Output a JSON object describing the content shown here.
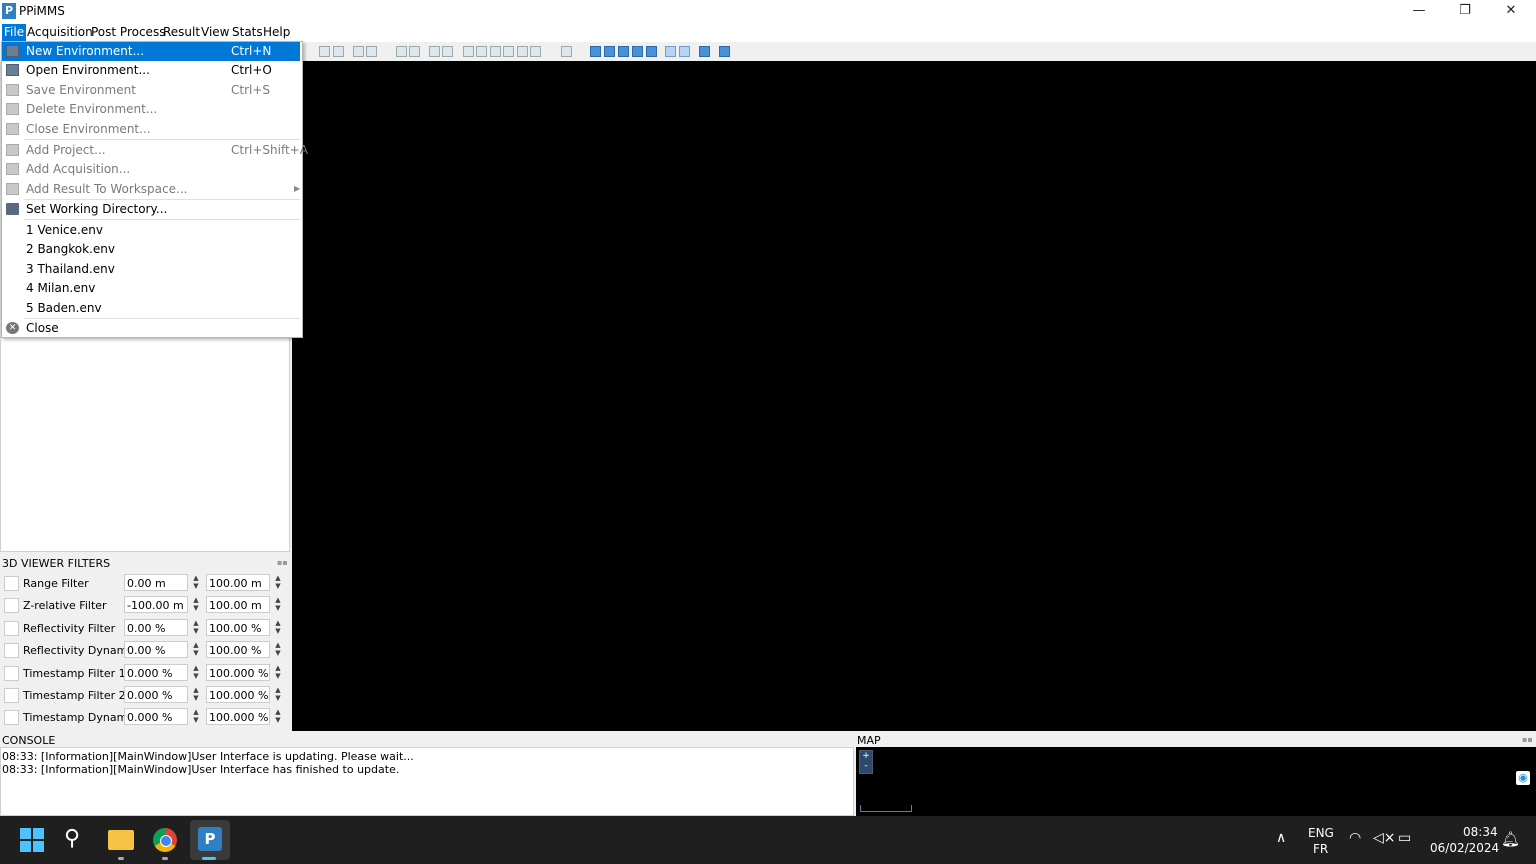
{
  "window": {
    "logo_letter": "P",
    "title": "PPiMMS",
    "controls": {
      "minimize": "—",
      "restore": "❐",
      "close": "✕"
    }
  },
  "menubar": [
    {
      "label": "File"
    },
    {
      "label": "Acquisition"
    },
    {
      "label": "Post Process"
    },
    {
      "label": "Result"
    },
    {
      "label": "View"
    },
    {
      "label": "Stats"
    },
    {
      "label": "Help"
    }
  ],
  "file_menu": {
    "items": [
      {
        "label": "New Environment...",
        "shortcut": "Ctrl+N",
        "enabled": true,
        "highlighted": true
      },
      {
        "label": "Open Environment...",
        "shortcut": "Ctrl+O",
        "enabled": true
      },
      {
        "label": "Save Environment",
        "shortcut": "Ctrl+S",
        "enabled": false
      },
      {
        "label": "Delete Environment...",
        "shortcut": "",
        "enabled": false
      },
      {
        "label": "Close Environment...",
        "shortcut": "",
        "enabled": false
      },
      {
        "label": "Add Project...",
        "shortcut": "Ctrl+Shift+A",
        "enabled": false
      },
      {
        "label": "Add Acquisition...",
        "shortcut": "",
        "enabled": false
      },
      {
        "label": "Add Result To Workspace...",
        "shortcut": "",
        "enabled": false
      },
      {
        "label": "Set Working Directory...",
        "shortcut": "",
        "enabled": true
      }
    ],
    "recent": [
      "1 Venice.env",
      "2 Bangkok.env",
      "3 Thailand.env",
      "4 Milan.env",
      "5 Baden.env"
    ],
    "close_label": "Close"
  },
  "filters": {
    "title": "3D VIEWER FILTERS",
    "rows": [
      {
        "label": "Range Filter",
        "min": "0.00 m",
        "max": "100.00 m"
      },
      {
        "label": "Z-relative Filter",
        "min": "-100.00 m",
        "max": "100.00 m"
      },
      {
        "label": "Reflectivity Filter",
        "min": "0.00 %",
        "max": "100.00 %"
      },
      {
        "label": "Reflectivity Dynamic",
        "min": "0.00 %",
        "max": "100.00 %"
      },
      {
        "label": "Timestamp Filter 1",
        "min": "0.000 %",
        "max": "100.000 %"
      },
      {
        "label": "Timestamp Filter 2",
        "min": "0.000 %",
        "max": "100.000 %"
      },
      {
        "label": "Timestamp Dynamic",
        "min": "0.000 %",
        "max": "100.000 %"
      }
    ]
  },
  "console": {
    "title": "CONSOLE",
    "lines": [
      "08:33: [Information][MainWindow]User Interface is updating. Please wait...",
      "08:33: [Information][MainWindow]User Interface has finished to update."
    ]
  },
  "map": {
    "title": "MAP",
    "zoom_in": "+",
    "zoom_out": "-"
  },
  "taskbar": {
    "language_primary": "ENG",
    "language_secondary": "FR",
    "time": "08:34",
    "date": "06/02/2024"
  },
  "colors": {
    "accent": "#0078d7",
    "viewer_bg": "#000000",
    "taskbar_bg": "#1f1f1f"
  }
}
